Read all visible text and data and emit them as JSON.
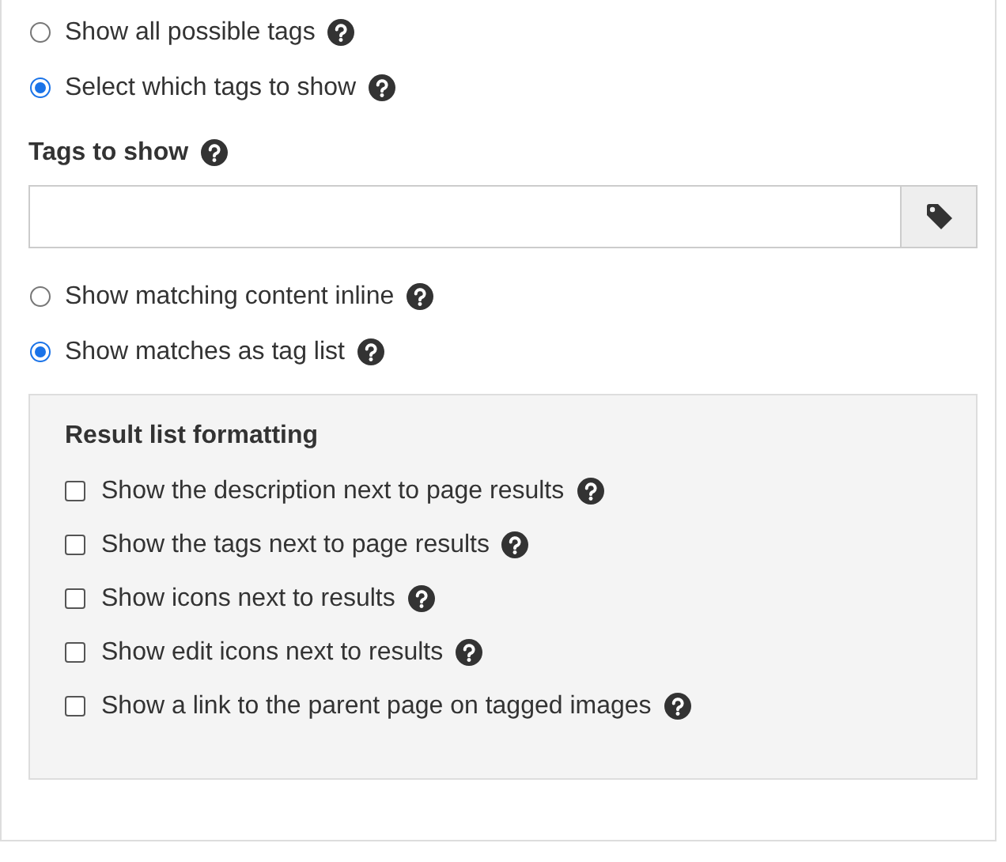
{
  "tag_source": [
    {
      "label": "Show all possible tags",
      "selected": false
    },
    {
      "label": "Select which tags to show",
      "selected": true
    }
  ],
  "tags_field": {
    "label": "Tags to show"
  },
  "display_mode": [
    {
      "label": "Show matching content inline",
      "selected": false
    },
    {
      "label": "Show matches as tag list",
      "selected": true
    }
  ],
  "result_formatting": {
    "title": "Result list formatting",
    "options": [
      {
        "label": "Show the description next to page results",
        "checked": false
      },
      {
        "label": "Show the tags next to page results",
        "checked": false
      },
      {
        "label": "Show icons next to results",
        "checked": false
      },
      {
        "label": "Show edit icons next to results",
        "checked": false
      },
      {
        "label": "Show a link to the parent page on tagged images",
        "checked": false
      }
    ]
  }
}
